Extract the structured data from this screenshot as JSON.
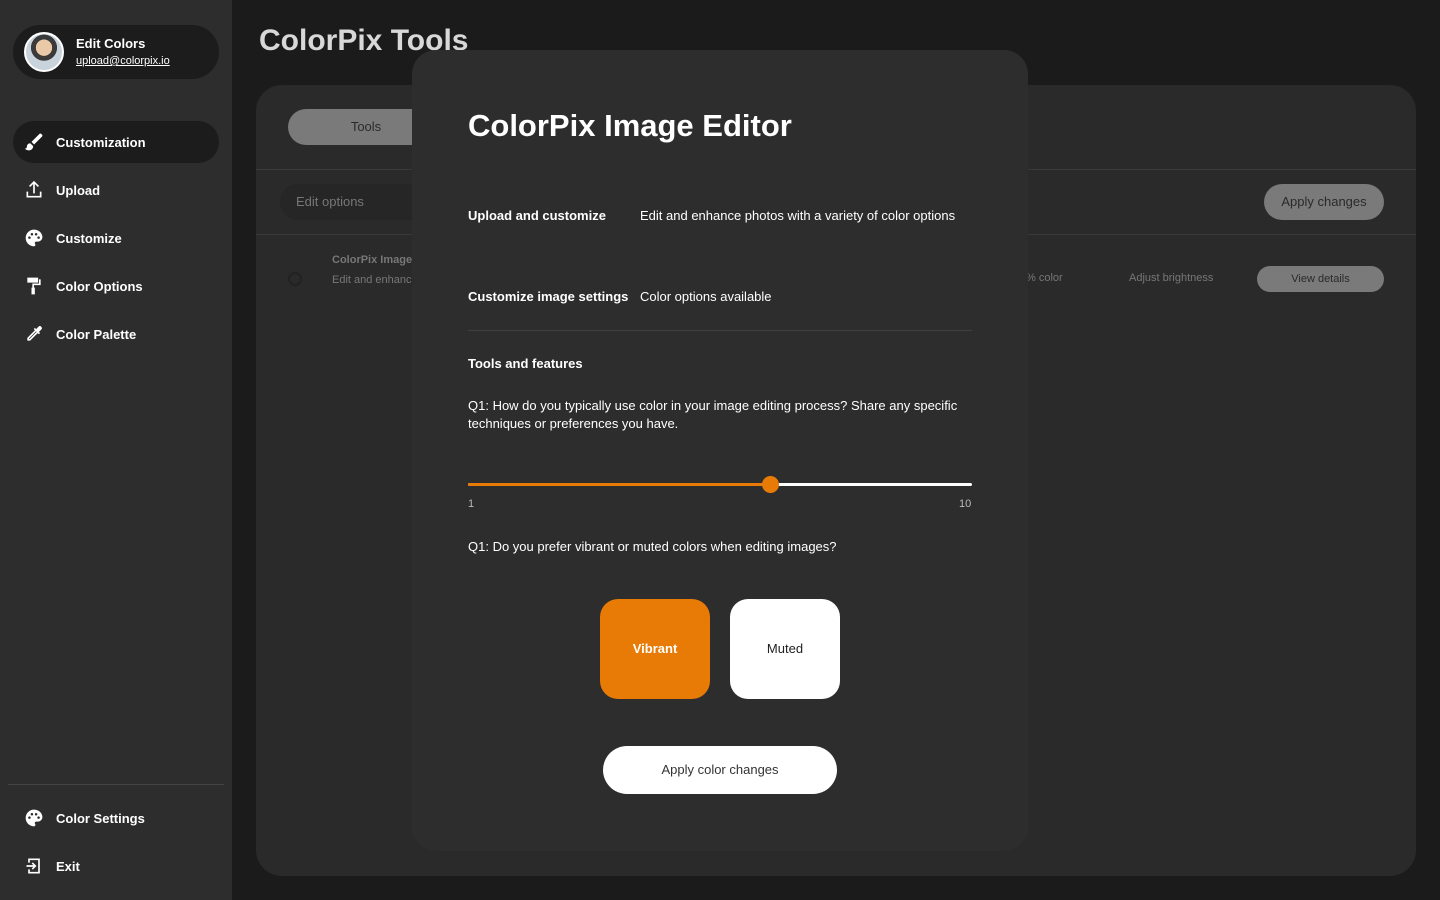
{
  "sidebar": {
    "profile": {
      "name": "Edit Colors",
      "email": "upload@colorpix.io"
    },
    "items": [
      {
        "label": "Customization",
        "icon": "brush-icon",
        "active": true
      },
      {
        "label": "Upload",
        "icon": "upload-icon"
      },
      {
        "label": "Customize",
        "icon": "palette-icon"
      },
      {
        "label": "Color Options",
        "icon": "paint-roller-icon"
      },
      {
        "label": "Color Palette",
        "icon": "eyedropper-icon"
      }
    ],
    "bottom_items": [
      {
        "label": "Color Settings",
        "icon": "palette-icon"
      },
      {
        "label": "Exit",
        "icon": "exit-icon"
      }
    ]
  },
  "main": {
    "title": "ColorPix Tools",
    "tab": "Tools",
    "edit_options": "Edit options",
    "apply_changes": "Apply changes",
    "row": {
      "title": "ColorPix Image",
      "subtitle": "Edit and enhanc",
      "color": "% color",
      "brightness": "Adjust brightness",
      "view": "View details"
    }
  },
  "modal": {
    "title": "ColorPix Image Editor",
    "info": [
      {
        "label": "Upload and customize",
        "value": "Edit and enhance photos with a variety of color options"
      },
      {
        "label": "Customize image settings",
        "value": "Color options available"
      }
    ],
    "section_title": "Tools and features",
    "question1": "Q1: How do you typically use color in your image editing process? Share any specific techniques or preferences you have.",
    "slider": {
      "min_label": "1",
      "max_label": "10",
      "min": 1,
      "max": 10,
      "value": 6.4
    },
    "question2": "Q1: Do you prefer vibrant or muted colors when editing images?",
    "choices": [
      "Vibrant",
      "Muted"
    ],
    "selected_choice": "Vibrant",
    "apply_button": "Apply color changes"
  },
  "colors": {
    "accent": "#e87b05",
    "background": "#1b1b1b",
    "sidebar": "#2d2d2d"
  }
}
